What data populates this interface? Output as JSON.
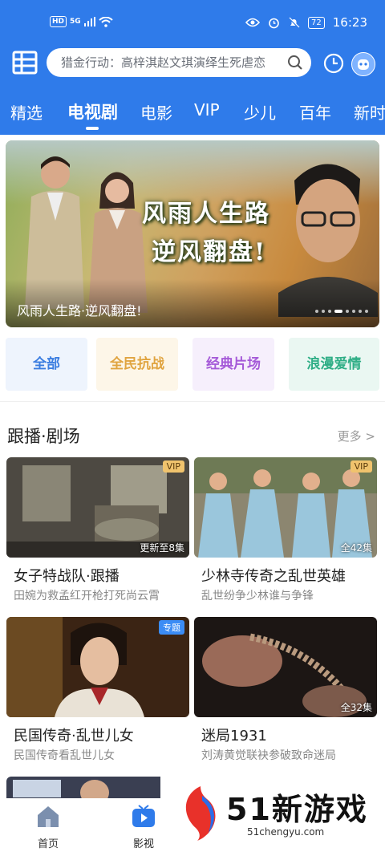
{
  "status_bar": {
    "hd": "HD",
    "signal": "5G",
    "battery": "72",
    "time": "16:23"
  },
  "search": {
    "placeholder_text": "猎金行动：高梓淇赵文琪演绎生死虐恋"
  },
  "tabs": [
    {
      "label": "精选"
    },
    {
      "label": "电视剧",
      "active": true
    },
    {
      "label": "电影"
    },
    {
      "label": "VIP"
    },
    {
      "label": "少儿"
    },
    {
      "label": "百年"
    },
    {
      "label": "新时"
    }
  ],
  "banner": {
    "title_line1": "风雨人生路",
    "title_line2": "逆风翻盘!",
    "caption": "风雨人生路·逆风翻盘!"
  },
  "categories": [
    {
      "label": "全部",
      "color": "#3b7de0",
      "bg": "#eef4fd"
    },
    {
      "label": "全民抗战",
      "color": "#e0a440",
      "bg": "#fdf6e8"
    },
    {
      "label": "经典片场",
      "color": "#a55ad8",
      "bg": "#f6effc"
    },
    {
      "label": "浪漫爱情",
      "color": "#2fae86",
      "bg": "#eaf7f2"
    }
  ],
  "section": {
    "title": "跟播·剧场",
    "more": "更多 >"
  },
  "cards": [
    {
      "title": "女子特战队·跟播",
      "subtitle": "田婉为救孟红开枪打死尚云霄",
      "badge": "VIP",
      "episodes": "更新至8集"
    },
    {
      "title": "少林寺传奇之乱世英雄",
      "subtitle": "乱世纷争少林谁与争锋",
      "badge": "VIP",
      "episodes": "全42集"
    },
    {
      "title": "民国传奇·乱世儿女",
      "subtitle": "民国传奇看乱世儿女",
      "badge": "专题",
      "episodes": ""
    },
    {
      "title": "迷局1931",
      "subtitle": "刘涛黄觉联袂参破致命迷局",
      "badge": "",
      "episodes": "全32集"
    }
  ],
  "bottom_nav": [
    {
      "label": "首页",
      "icon": "home-icon"
    },
    {
      "label": "影视",
      "icon": "tv-icon",
      "active": true
    }
  ],
  "watermark": {
    "text": "51新游戏",
    "url": "51chengyu.com"
  },
  "colors": {
    "brand_blue": "#2f7bea",
    "accent_gold": "#e0a440"
  }
}
